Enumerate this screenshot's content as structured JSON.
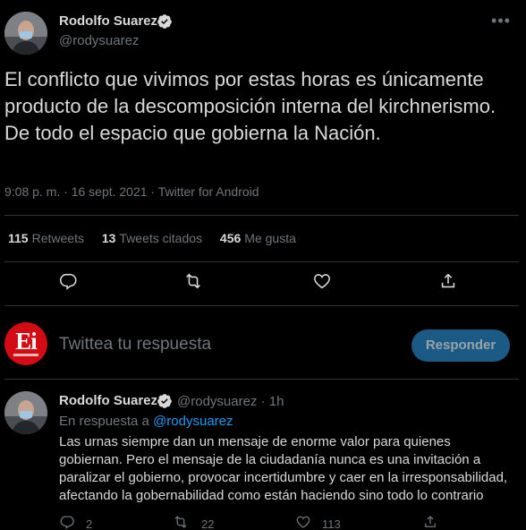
{
  "main_tweet": {
    "author_name": "Rodolfo Suarez",
    "author_handle": "@rodysuarez",
    "more_glyph": "•••",
    "text": "El conflicto que vivimos por estas horas es únicamente producto de la descomposición interna del kirchnerismo. De todo el espacio que gobierna la Nación.",
    "meta": "9:08 p. m. · 16 sept. 2021 · Twitter for Android",
    "stats": {
      "retweets_count": "115",
      "retweets_label": "Retweets",
      "quotes_count": "13",
      "quotes_label": "Tweets citados",
      "likes_count": "456",
      "likes_label": "Me gusta"
    },
    "actions": [
      "reply-icon",
      "retweet-icon",
      "like-icon",
      "share-icon"
    ]
  },
  "reply_bar": {
    "logo_text": "Ei",
    "placeholder": "Twittea tu respuesta",
    "button_label": "Responder"
  },
  "second_tweet": {
    "author_name": "Rodolfo Suarez",
    "author_handle": "@rodysuarez · 1h",
    "reply_prefix": "En respuesta a",
    "reply_target": "@rodysuarez",
    "text": "Las urnas siempre dan un mensaje de enorme valor para quienes gobiernan. Pero el mensaje de la ciudadanía nunca es una invitación a paralizar el gobierno, provocar incertidumbre y caer en la irresponsabilidad, afectando la gobernabilidad como están haciendo sino todo lo contrario",
    "replies_count": "2",
    "retweets_count": "22",
    "likes_count": "113"
  },
  "colors": {
    "background": "#000000",
    "text": "#d9d9d9",
    "muted": "#6e767d",
    "accent": "#1d9bf0",
    "button_bg": "#1a5a85",
    "logo_red": "#d20b14",
    "divider": "#2f3336"
  }
}
